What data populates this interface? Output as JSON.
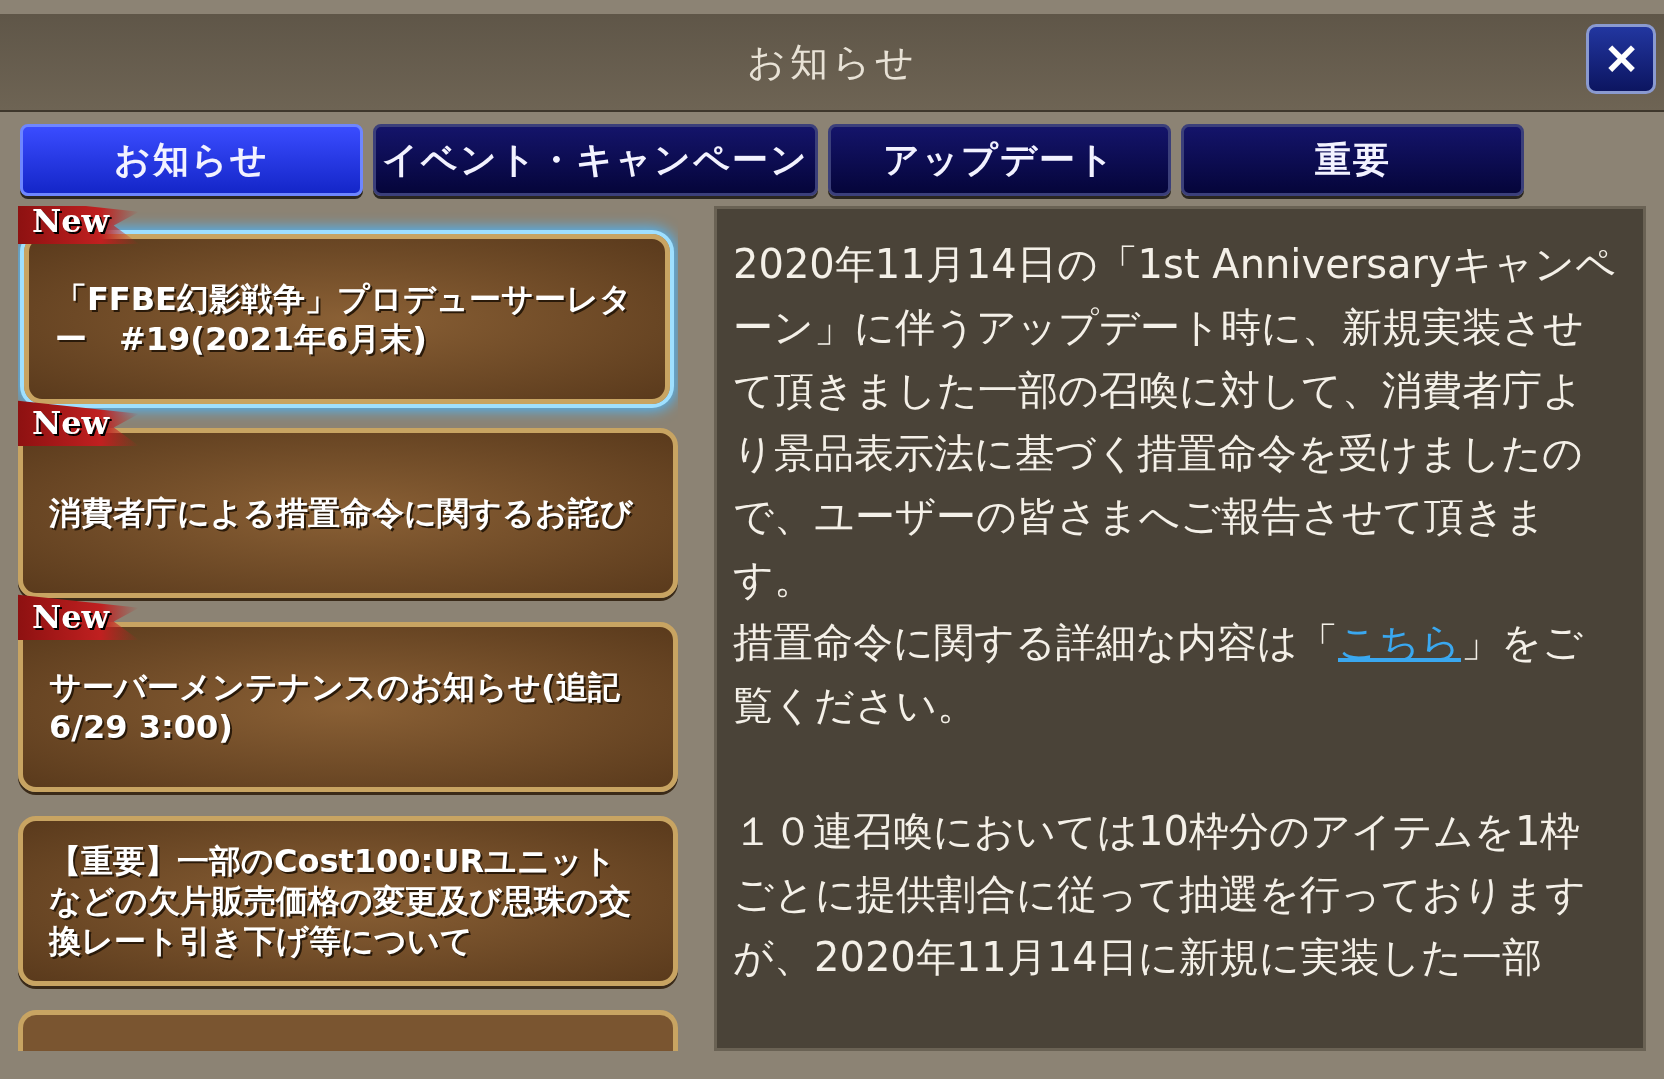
{
  "window": {
    "title": "お知らせ",
    "close_label": "✕"
  },
  "tabs": [
    {
      "label": "お知らせ",
      "selected": true
    },
    {
      "label": "イベント・キャンペーン",
      "selected": false
    },
    {
      "label": "アップデート",
      "selected": false
    },
    {
      "label": "重要",
      "selected": false
    }
  ],
  "notices": [
    {
      "title": "「FFBE幻影戦争」プロデューサーレター　#19(2021年6月末)",
      "badge": "New",
      "selected": true
    },
    {
      "title": "消費者庁による措置命令に関するお詫び",
      "badge": "New",
      "selected": false
    },
    {
      "title": "サーバーメンテナンスのお知らせ(追記6/29 3:00)",
      "badge": "New",
      "selected": false
    },
    {
      "title": "【重要】一部のCost100:URユニットなどの欠片販売価格の変更及び思珠の交換レート引き下げ等について",
      "selected": false
    }
  ],
  "detail": [
    {
      "kind": "text",
      "text": "2020年11月14日の「1st Anniversaryキャンペーン」に伴うアップデート時に、新規実装させて頂きました一部の召喚に対して、消費者庁より景品表示法に基づく措置命令を受けましたので、ユーザーの皆さまへご報告させて頂きます。"
    },
    {
      "kind": "link",
      "before": "措置命令に関する詳細な内容は「",
      "link": "こちら",
      "after": "」をご覧ください。"
    },
    {
      "kind": "gap"
    },
    {
      "kind": "text",
      "text": "１０連召喚においては10枠分のアイテムを1枠ごとに提供割合に従って抽選を行っておりますが、2020年11月14日に新規に実装した一部"
    }
  ]
}
